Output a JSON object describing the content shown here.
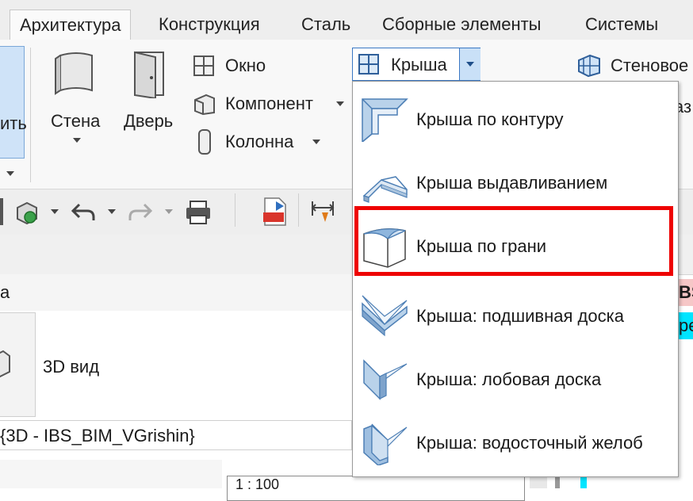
{
  "tabs": [
    "Архитектура",
    "Конструкция",
    "Сталь",
    "Сборные элементы",
    "Системы"
  ],
  "ribbon": {
    "partial_left_label": "ить",
    "wall_label": "Стена",
    "door_label": "Дверь",
    "window_label": "Окно",
    "component_label": "Компонент",
    "column_label": "Колонна",
    "roof_button_label": "Крыша",
    "curtain_label": "Стеновое",
    "partial_right": "аз"
  },
  "dropdown": {
    "items": [
      {
        "label": "Крыша по контуру",
        "icon": "roof-by-footprint-icon"
      },
      {
        "label": "Крыша выдавливанием",
        "icon": "roof-by-extrusion-icon"
      },
      {
        "label": "Крыша по грани",
        "icon": "roof-by-face-icon",
        "highlighted": true
      },
      {
        "label": "Крыша: подшивная доска",
        "icon": "roof-soffit-icon"
      },
      {
        "label": "Крыша: лобовая доска",
        "icon": "roof-fascia-icon"
      },
      {
        "label": "Крыша: водосточный желоб",
        "icon": "roof-gutter-icon"
      }
    ]
  },
  "properties": {
    "header_partial": "а",
    "type_label": "3D вид",
    "view_selector": "{3D - IBS_BIM_VGrishin}",
    "bottom_partial": "1 : 100"
  },
  "right_edge": {
    "partial_1": "BS",
    "partial_2": "ре"
  },
  "colors": {
    "highlight_red": "#ee0000",
    "cyan_strip": "#00e5ff",
    "ribbon_selected_blue": "#c9e0f7"
  }
}
